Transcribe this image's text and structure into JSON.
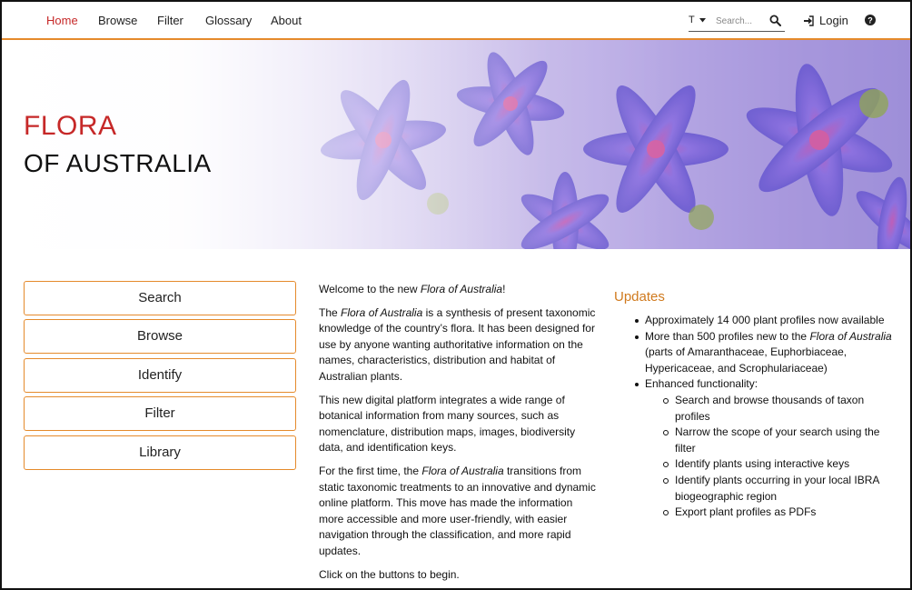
{
  "nav": {
    "items": [
      {
        "label": "Home",
        "active": true
      },
      {
        "label": "Browse",
        "active": false
      },
      {
        "label": "Filter",
        "active": false
      },
      {
        "label": "Glossary",
        "active": false
      },
      {
        "label": "About",
        "active": false
      }
    ],
    "search_type": "T",
    "search_placeholder": "Search...",
    "login_label": "Login"
  },
  "hero": {
    "title_line1": "FLORA",
    "title_line2": "OF AUSTRALIA"
  },
  "side_buttons": [
    "Search",
    "Browse",
    "Identify",
    "Filter",
    "Library"
  ],
  "intro": {
    "p1_before": "Welcome to the new ",
    "p1_em": "Flora of Australia",
    "p1_after": "!",
    "p2_before": "The ",
    "p2_em": "Flora of Australia",
    "p2_after": " is a synthesis of present taxonomic knowledge of the country’s flora. It has been designed for use by anyone wanting authoritative information on the names, characteristics, distribution and habitat of Australian plants.",
    "p3": "This new digital platform integrates a wide range of botanical information from many sources, such as nomenclature, distribution maps, images, biodiversity data, and identification keys.",
    "p4_before": "For the first time, the ",
    "p4_em": "Flora of Australia",
    "p4_after": " transitions from static taxonomic treatments to an innovative and dynamic online platform. This move has made the information more accessible and more user-friendly, with easier navigation through the classification, and more rapid updates.",
    "p5": "Click on the buttons to begin."
  },
  "updates": {
    "title": "Updates",
    "item1": "Approximately 14 000 plant profiles now available",
    "item2_before": "More than 500 profiles new to the ",
    "item2_em": "Flora of Australia",
    "item2_after": " (parts of Amaranthaceae, Euphorbiaceae, Hypericaceae, and Scrophulariaceae)",
    "item3": "Enhanced functionality:",
    "sub": [
      "Search and browse thousands of taxon profiles",
      "Narrow the scope of your search using the filter",
      "Identify plants using interactive keys",
      "Identify plants occurring in your local IBRA biogeographic region",
      "Export plant profiles as PDFs"
    ]
  },
  "colors": {
    "accent": "#e58a2b",
    "brand_red": "#c62828",
    "updates_title": "#d07a1e"
  },
  "icons": [
    "caret-down-icon",
    "search-icon",
    "login-icon",
    "question-circle-icon"
  ]
}
